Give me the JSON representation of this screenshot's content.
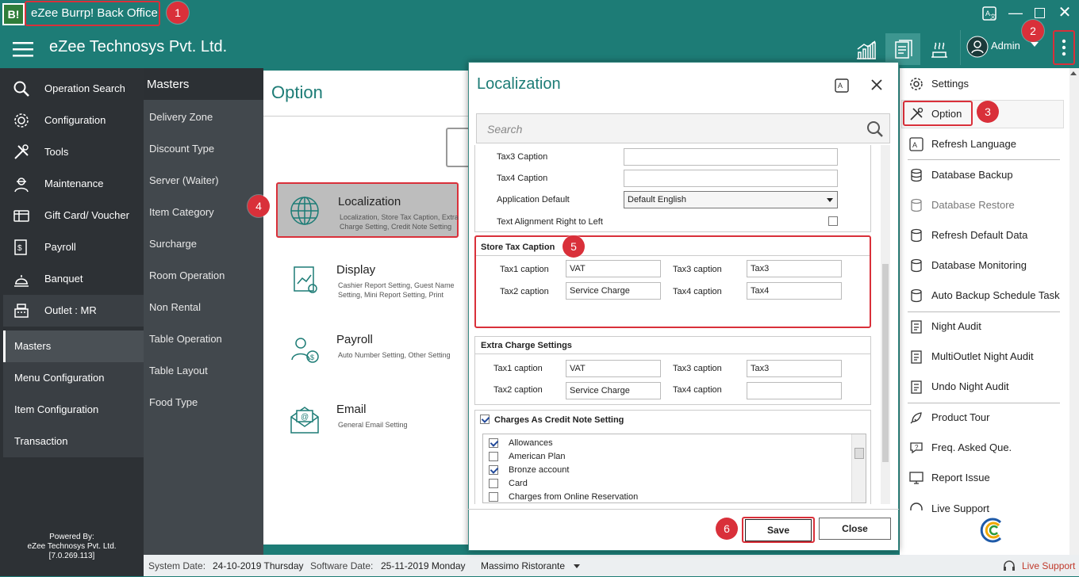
{
  "app": {
    "logo_text": "B!",
    "title": "eZee Burrp! Back Office",
    "company": "eZee Technosys Pvt. Ltd.",
    "user": "Admin"
  },
  "badges": [
    "1",
    "2",
    "3",
    "4",
    "5",
    "6"
  ],
  "sidebar": {
    "items": [
      {
        "label": "Operation Search",
        "icon": "search-icon"
      },
      {
        "label": "Configuration",
        "icon": "gear-icon"
      },
      {
        "label": "Tools",
        "icon": "tools-icon"
      },
      {
        "label": "Maintenance",
        "icon": "worker-icon"
      },
      {
        "label": "Gift Card/ Voucher",
        "icon": "gift-card-icon"
      },
      {
        "label": "Payroll",
        "icon": "payroll-icon"
      },
      {
        "label": "Banquet",
        "icon": "banquet-icon"
      },
      {
        "label": "Outlet : MR",
        "icon": "register-icon"
      }
    ],
    "sub_items": [
      "Masters",
      "Menu Configuration",
      "Item Configuration",
      "Transaction"
    ],
    "powered_by": [
      "Powered By:",
      "eZee Technosys Pvt. Ltd.",
      "[7.0.269.113]"
    ]
  },
  "masters": {
    "title": "Masters",
    "items": [
      "Delivery Zone",
      "Discount Type",
      "Server (Waiter)",
      "Item Category",
      "Surcharge",
      "Room Operation",
      "Non Rental",
      "Table Operation",
      "Table Layout",
      "Food Type"
    ]
  },
  "option_panel": {
    "title": "Option",
    "cards": [
      {
        "title": "Localization",
        "desc": "Localization, Store Tax Caption, Extra Charge Setting, Credit Note Setting"
      },
      {
        "title": "Display",
        "desc": "Cashier Report Setting, Guest Name Setting, Mini Report Setting, Print"
      },
      {
        "title": "Payroll",
        "desc": "Auto Number Setting, Other Setting"
      },
      {
        "title": "Email",
        "desc": "General Email Setting"
      }
    ]
  },
  "right_menu": {
    "items": [
      {
        "label": "Settings"
      },
      {
        "label": "Option"
      },
      {
        "label": "Refresh Language"
      },
      {
        "label": "Database Backup"
      },
      {
        "label": "Database Restore"
      },
      {
        "label": "Refresh Default Data"
      },
      {
        "label": "Database Monitoring"
      },
      {
        "label": "Auto Backup Schedule Task"
      },
      {
        "label": "Night Audit"
      },
      {
        "label": "MultiOutlet Night Audit"
      },
      {
        "label": "Undo Night Audit"
      },
      {
        "label": "Product Tour"
      },
      {
        "label": "Freq. Asked Que."
      },
      {
        "label": "Report Issue"
      },
      {
        "label": "Live Support"
      }
    ]
  },
  "dialog": {
    "title": "Localization",
    "search_placeholder": "Search",
    "top_fields": {
      "tax3_label": "Tax3 Caption",
      "tax3_value": "",
      "tax4_label": "Tax4 Caption",
      "tax4_value": "",
      "app_default_label": "Application Default",
      "app_default_value": "Default English",
      "align_label": "Text Alignment Right to Left"
    },
    "store_tax": {
      "heading": "Store Tax Caption",
      "tax1_label": "Tax1 caption",
      "tax1_value": "VAT",
      "tax2_label": "Tax2 caption",
      "tax2_value": "Service Charge",
      "tax3_label": "Tax3 caption",
      "tax3_value": "Tax3",
      "tax4_label": "Tax4 caption",
      "tax4_value": "Tax4"
    },
    "extra_charge": {
      "heading": "Extra Charge Settings",
      "tax1_label": "Tax1 caption",
      "tax1_value": "VAT",
      "tax2_label": "Tax2 caption",
      "tax2_value": "Service Charge",
      "tax3_label": "Tax3 caption",
      "tax3_value": "Tax3",
      "tax4_label": "Tax4 caption",
      "tax4_value": ""
    },
    "credit_note": {
      "heading": "Charges As Credit Note Setting",
      "items": [
        {
          "label": "Allowances",
          "checked": true
        },
        {
          "label": "American Plan",
          "checked": false
        },
        {
          "label": "Bronze account",
          "checked": true
        },
        {
          "label": "Card",
          "checked": false
        },
        {
          "label": "Charges from Online Reservation",
          "checked": false
        }
      ]
    },
    "save_label": "Save",
    "close_label": "Close"
  },
  "status": {
    "system_date_label": "System Date:",
    "system_date": "24-10-2019 Thursday",
    "software_date_label": "Software Date:",
    "software_date": "25-11-2019 Monday",
    "outlet": "Massimo Ristorante",
    "live_support": "Live Support"
  },
  "colors": {
    "teal": "#1d7c76",
    "accent_red": "#d9303a",
    "sidebar": "#2d3135"
  }
}
